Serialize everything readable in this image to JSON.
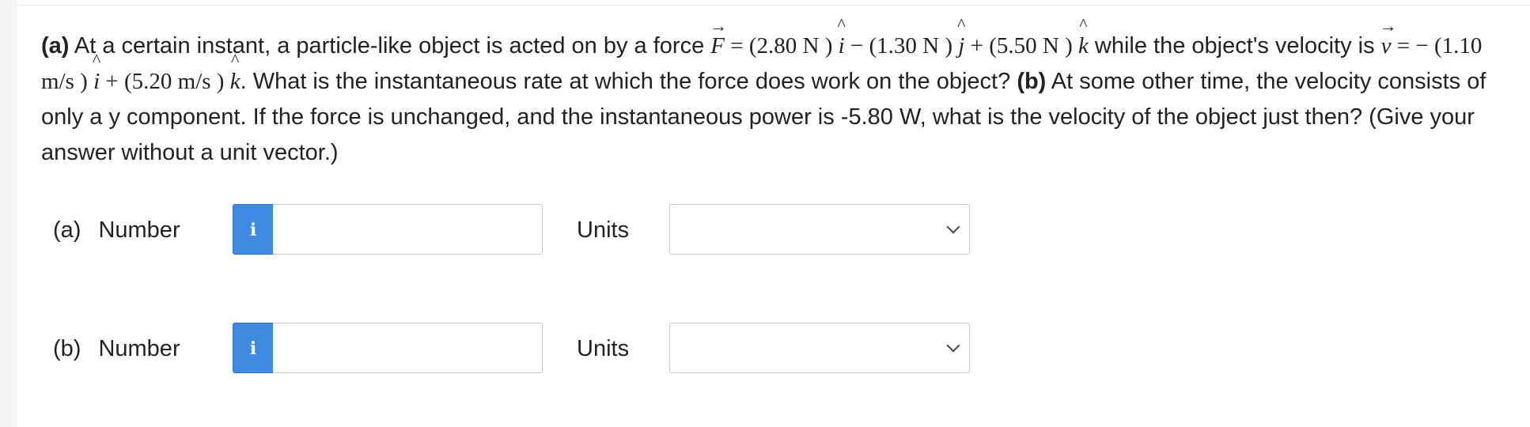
{
  "question": {
    "a_tag": "(a)",
    "a_text_1": " At a certain instant, a particle-like object is acted on by a force ",
    "F_symbol": "F",
    "F_eq": " = (2.80 N ) ",
    "i_hat_1": "i",
    "F_mid_1": " − (1.30 N ) ",
    "j_hat": "j",
    "F_mid_2": " + (5.50 N ) ",
    "k_hat_1": "k",
    "a_text_2": " while the object's velocity is ",
    "v_symbol": "v",
    "v_eq": " = − (1.10 m/s ) ",
    "i_hat_2": "i",
    "v_mid": " + (5.20 m/s ) ",
    "k_hat_2": "k",
    "a_text_3": ". What is the instantaneous rate at which the force does work on the object? ",
    "b_tag": "(b)",
    "b_text": " At some other time, the velocity consists of only a y component. If the force is unchanged, and the instantaneous power is -5.80 W, what is the velocity of the object just then? (Give your answer without a unit vector.)",
    "arrow_glyph": "→",
    "hat_glyph": "^"
  },
  "answers": [
    {
      "part": "(a)",
      "number_label": "Number",
      "info_glyph": "i",
      "number_value": "",
      "units_label": "Units",
      "units_selected": ""
    },
    {
      "part": "(b)",
      "number_label": "Number",
      "info_glyph": "i",
      "number_value": "",
      "units_label": "Units",
      "units_selected": ""
    }
  ],
  "colors": {
    "info_button": "#3d8ae0",
    "border": "#c9c9c9",
    "text": "#222222"
  }
}
